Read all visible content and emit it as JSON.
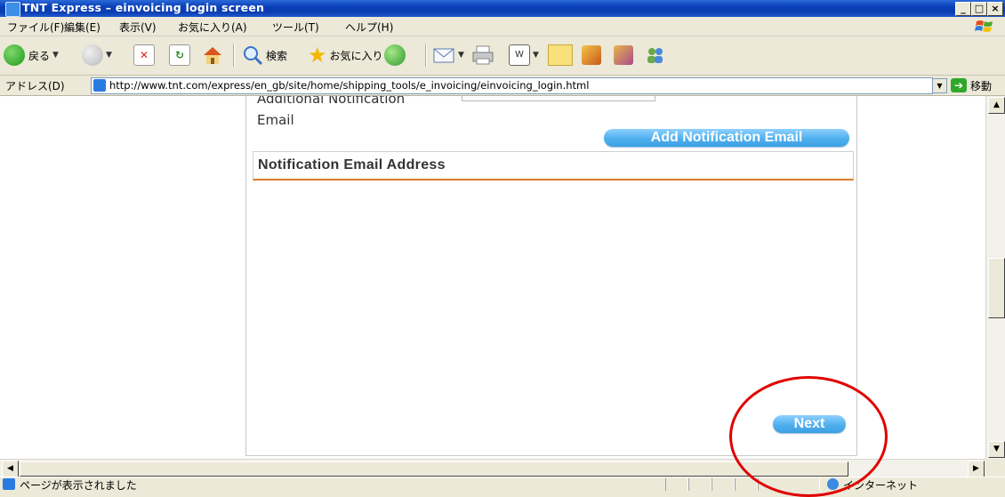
{
  "window": {
    "title": "TNT Express – einvoicing login screen"
  },
  "menu": {
    "items": [
      "ファイル(F)",
      "編集(E)",
      "表示(V)",
      "お気に入り(A)",
      "ツール(T)",
      "ヘルプ(H)"
    ]
  },
  "toolbar": {
    "back_label": "戻る",
    "search_label": "検索",
    "favorites_label": "お気に入り"
  },
  "address": {
    "label": "アドレス(D)",
    "url": "http://www.tnt.com/express/en_gb/site/home/shipping_tools/e_invoicing/einvoicing_login.html",
    "go_label": "移動"
  },
  "page": {
    "partial_label": "Additional Notification",
    "email_label": "Email",
    "add_button": "Add Notification Email",
    "notification_header": "Notification Email Address",
    "next_button": "Next"
  },
  "status": {
    "text": "ページが表示されました",
    "zone": "インターネット"
  },
  "colors": {
    "title_bar": "#0a3fb8",
    "button_blue": "#4fb0ef",
    "header_underline": "#d97a2a",
    "annotation_red": "#e00000"
  }
}
